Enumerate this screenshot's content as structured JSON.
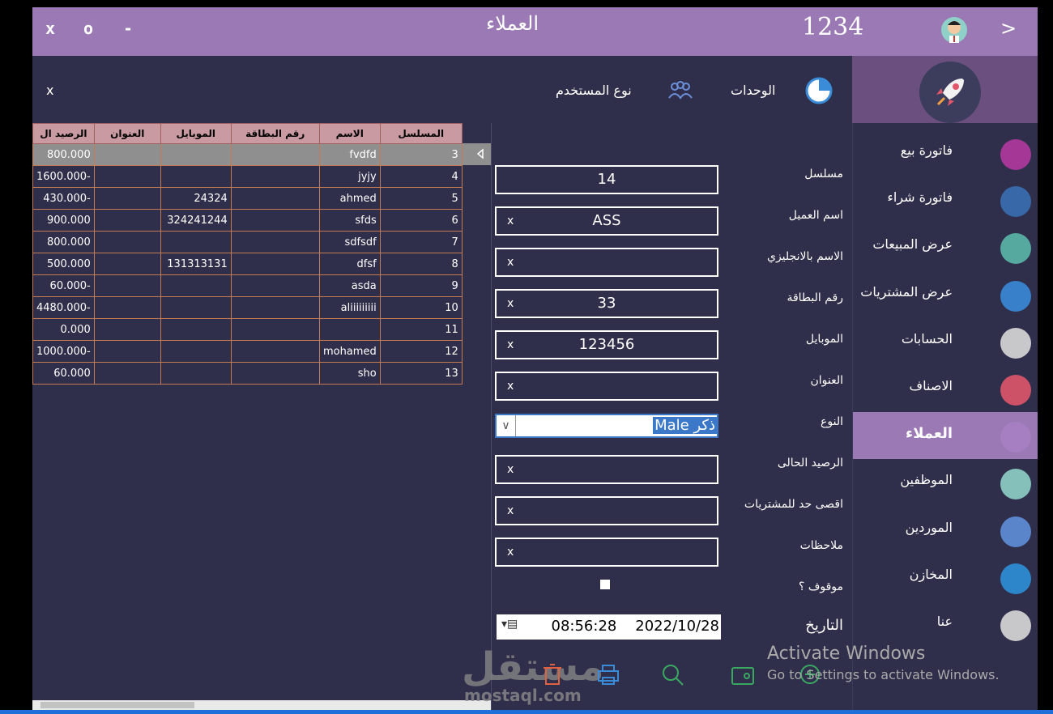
{
  "window": {
    "close": "x",
    "maximize": "o",
    "minimize": "-",
    "title": "العملاء",
    "code": "1234",
    "back": ">"
  },
  "toolbar": {
    "units": "الوحدات",
    "user_type": "نوع المستخدم",
    "close": "x"
  },
  "sidebar": {
    "items": [
      {
        "label": "فاتورة بيع",
        "icon": "register-icon",
        "color": "#b23aa0"
      },
      {
        "label": "فاتورة شراء",
        "icon": "cart-icon",
        "color": "#3a6fb2"
      },
      {
        "label": "عرض المبيعات",
        "icon": "trolley-icon",
        "color": "#5ab7a8"
      },
      {
        "label": "عرض المشتريات",
        "icon": "truck-icon",
        "color": "#3a8bd8"
      },
      {
        "label": "الحسابات",
        "icon": "pie-chart-icon",
        "color": "#d9d9d9"
      },
      {
        "label": "الاصناف",
        "icon": "pills-icon",
        "color": "#e0566a"
      },
      {
        "label": "العملاء",
        "icon": "user-circle-icon",
        "color": "#b68bd6"
      },
      {
        "label": "الموظفين",
        "icon": "person-icon",
        "color": "#8fd0c8"
      },
      {
        "label": "الموردين",
        "icon": "delivery-truck-icon",
        "color": "#5f8fd8"
      },
      {
        "label": "المخازن",
        "icon": "store-bag-icon",
        "color": "#2e8fd8"
      },
      {
        "label": "عنا",
        "icon": "info-icon",
        "color": "#d9d9d9"
      }
    ]
  },
  "form": {
    "labels": [
      "مسلسل",
      "اسم العميل",
      "الاسم بالانجليزي",
      "رقم البطاقة",
      "الموبايل",
      "العنوان",
      "النوع",
      "الرصيد الحالى",
      "اقصى حد للمشتريات",
      "ملاحظات",
      "موقوف ؟",
      "التاريخ"
    ],
    "fields": [
      {
        "x": "",
        "value": "14"
      },
      {
        "x": "x",
        "value": "ASS"
      },
      {
        "x": "x",
        "value": ""
      },
      {
        "x": "x",
        "value": "33"
      },
      {
        "x": "x",
        "value": "123456"
      },
      {
        "x": "x",
        "value": ""
      },
      {
        "x": "x",
        "value": ""
      },
      {
        "x": "x",
        "value": ""
      },
      {
        "x": "x",
        "value": ""
      }
    ],
    "gender": "Male ذكر",
    "gender_arrow": "∨",
    "suspended": false,
    "date": "2022/10/28",
    "time": "08:56:28",
    "date_dropdown": "▾▤"
  },
  "table": {
    "headers": [
      "الرصيد ال",
      "العنوان",
      "الموبايل",
      "رقم البطاقة",
      "الاسم",
      "المسلسل"
    ],
    "rows": [
      [
        "800.000",
        "",
        "",
        "",
        "fvdfd",
        "3"
      ],
      [
        "1600.000-",
        "",
        "",
        "",
        "jyjy",
        "4"
      ],
      [
        "430.000-",
        "",
        "24324",
        "",
        "ahmed",
        "5"
      ],
      [
        "900.000",
        "",
        "324241244",
        "",
        "sfds",
        "6"
      ],
      [
        "800.000",
        "",
        "",
        "",
        "sdfsdf",
        "7"
      ],
      [
        "500.000",
        "",
        "131313131",
        "",
        "dfsf",
        "8"
      ],
      [
        "60.000-",
        "",
        "",
        "",
        "asda",
        "9"
      ],
      [
        "4480.000-",
        "",
        "",
        "",
        "aliiiiiiiii",
        "10"
      ],
      [
        "0.000",
        "",
        "",
        "",
        "",
        "11"
      ],
      [
        "1000.000-",
        "",
        "",
        "",
        "mohamed",
        "12"
      ],
      [
        "60.000",
        "",
        "",
        "",
        "sho",
        "13"
      ]
    ],
    "selected_index": 0
  },
  "actions": [
    {
      "icon": "trash-icon",
      "color": "#e06040"
    },
    {
      "icon": "printer-icon",
      "color": "#3a8bd8"
    },
    {
      "icon": "search-icon",
      "color": "#3aa860"
    },
    {
      "icon": "wallet-icon",
      "color": "#3aa860"
    },
    {
      "icon": "add-money-icon",
      "color": "#3aa860"
    }
  ],
  "overlay": {
    "activate_title": "Activate Windows",
    "activate_sub": "Go to Settings to activate Windows.",
    "watermark": "مستقل",
    "watermark_sub": "mostaql.com"
  }
}
